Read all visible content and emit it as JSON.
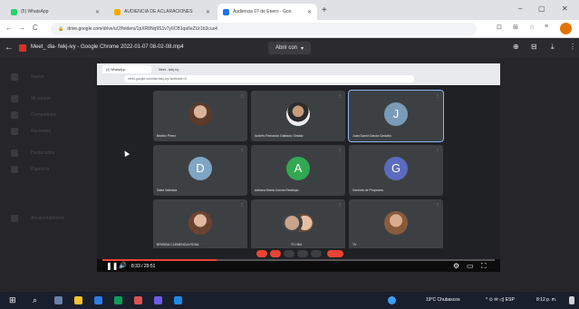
{
  "browser": {
    "tabs": [
      {
        "label": "(5) WhatsApp",
        "color": "#25d366",
        "active": false
      },
      {
        "label": "AUDIENCIA DE ACLARACIONES",
        "color": "#f9ab00",
        "active": false
      },
      {
        "label": "Audiencia 07 de Enero - Goo",
        "color": "#1a73e8",
        "active": true
      }
    ],
    "new_tab": "+",
    "window_controls": {
      "minimize": "–",
      "maximize": "▢",
      "close": "✕"
    },
    "nav": {
      "back": "←",
      "forward": "→",
      "reload": "C"
    },
    "url": "drive.google.com/drive/u/2/folders/1pXR8Nq9S1v7y6CB1qa6eZUr1b3cux4",
    "toolbar_icons": [
      "⊡",
      "⊞",
      "☆",
      "≡"
    ]
  },
  "viewer": {
    "back_icon": "←",
    "filename": "Meet_ dia- fwkj-ivy - Google Chrome 2022-01-07 08-02-08.mp4",
    "open_with_label": "Abrir con",
    "open_with_caret": "▾",
    "right_icons": [
      "⊕",
      "⊟",
      "⤓",
      "⋮"
    ]
  },
  "drive_sidebar": [
    "Nuevo",
    "Mi unidad",
    "Compartidos",
    "Recientes",
    "Destacados",
    "Papelera",
    "Almacenamiento"
  ],
  "video": {
    "inner_tabs": [
      "(2) WhatsApp",
      "Meet - fwkj-ivy"
    ],
    "inner_url": "meet.google.com/dia-fwkj-ivy?authuser=0",
    "participants": [
      {
        "name": "Beatriz Perez",
        "kind": "photo",
        "variant": "p1"
      },
      {
        "name": "Andrés Fernando Galeano Giraldo",
        "kind": "photo",
        "variant": "p2"
      },
      {
        "name": "Juan David Garcia Castaño",
        "kind": "letter",
        "letter": "J",
        "color": "#7a9bb7",
        "highlight": true
      },
      {
        "name": "Dalia Valencia",
        "kind": "letter",
        "letter": "D",
        "color": "#7fa6c4"
      },
      {
        "name": "Adriana Maria Correa Restrepo",
        "kind": "letter",
        "letter": "A",
        "color": "#33a852"
      },
      {
        "name": "Gerente de Proyectos",
        "kind": "letter",
        "letter": "G",
        "color": "#5c6bc0"
      },
      {
        "name": "BRIGIDA CLEMENCIA ROSA",
        "kind": "photo",
        "variant": "p3"
      },
      {
        "name": "TY HMI",
        "kind": "photo",
        "variant": "pair"
      },
      {
        "name": "TV",
        "kind": "photo",
        "variant": "p4"
      }
    ],
    "player": {
      "play_icon": "❚❚",
      "volume_icon": "🔊",
      "time": "8:33 / 29:51",
      "progress": 0.29,
      "right_icons": [
        "⚙",
        "▭",
        "⛶"
      ]
    }
  },
  "taskbar": {
    "start_icon": "⊞",
    "search_icon": "⌕",
    "weather": "19°C Chubascos",
    "tray_icons": "^ ⊙ ✉ ◁) ESP",
    "clock": "8:12 p. m."
  }
}
